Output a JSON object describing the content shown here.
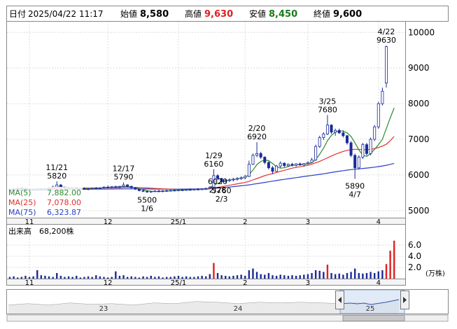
{
  "header": {
    "date_label": "日付",
    "datetime": "2025/04/22 11:17",
    "open_label": "始値",
    "open_value": "8,580",
    "high_label": "高値",
    "high_value": "9,630",
    "low_label": "安値",
    "low_value": "8,450",
    "close_label": "終値",
    "close_value": "9,600"
  },
  "legend": [
    {
      "label": "MA(5)",
      "value": "7,882.00",
      "color": "#2e8b2e"
    },
    {
      "label": "MA(25)",
      "value": "7,078.00",
      "color": "#e03030"
    },
    {
      "label": "MA(75)",
      "value": "6,323.87",
      "color": "#2a40c8"
    }
  ],
  "volume_panel": {
    "title": "出来高",
    "value": "68,200株",
    "unit": "(万株)",
    "ticks": [
      "6.0",
      "4.0",
      "2.0"
    ]
  },
  "navigator": {
    "year_labels": [
      "23",
      "24",
      "25"
    ]
  },
  "colors": {
    "up": "#ffffff",
    "down": "#1a2a9a",
    "vol_normal": "#1a2a9a",
    "vol_high": "#e02020",
    "ma5": "#2e8b2e",
    "ma25": "#e03030",
    "ma75": "#2a40c8"
  },
  "chart_data": {
    "type": "candlestick",
    "x_months": [
      "11",
      "12",
      "25/1",
      "2",
      "3",
      "4"
    ],
    "y_ticks": [
      5000,
      6000,
      7000,
      8000,
      9000,
      10000
    ],
    "ylim": [
      4800,
      10300
    ],
    "annotations": [
      {
        "date": "11/21",
        "value": "5820",
        "position": "above"
      },
      {
        "date": "12/17",
        "value": "5790",
        "position": "above"
      },
      {
        "date": "1/6",
        "value": "5500",
        "position": "below"
      },
      {
        "date": "1/29",
        "value": "6160",
        "position": "above"
      },
      {
        "date": "2/3",
        "value": "5760",
        "position": "below"
      },
      {
        "date": "2/20",
        "value": "6920",
        "position": "above"
      },
      {
        "date": "2/28",
        "value": "6020",
        "position": "below"
      },
      {
        "date": "3/25",
        "value": "7680",
        "position": "above"
      },
      {
        "date": "4/7",
        "value": "5890",
        "position": "below"
      },
      {
        "date": "4/22",
        "value": "9630",
        "position": "above"
      }
    ],
    "candles": [
      {
        "o": 5590,
        "h": 5620,
        "l": 5560,
        "c": 5600
      },
      {
        "o": 5600,
        "h": 5640,
        "l": 5580,
        "c": 5610
      },
      {
        "o": 5610,
        "h": 5650,
        "l": 5590,
        "c": 5630
      },
      {
        "o": 5630,
        "h": 5660,
        "l": 5600,
        "c": 5620
      },
      {
        "o": 5620,
        "h": 5650,
        "l": 5580,
        "c": 5600
      },
      {
        "o": 5600,
        "h": 5620,
        "l": 5560,
        "c": 5580
      },
      {
        "o": 5580,
        "h": 5610,
        "l": 5550,
        "c": 5590
      },
      {
        "o": 5590,
        "h": 5630,
        "l": 5570,
        "c": 5610
      },
      {
        "o": 5610,
        "h": 5640,
        "l": 5580,
        "c": 5600
      },
      {
        "o": 5600,
        "h": 5630,
        "l": 5570,
        "c": 5620
      },
      {
        "o": 5620,
        "h": 5660,
        "l": 5600,
        "c": 5640
      },
      {
        "o": 5640,
        "h": 5700,
        "l": 5610,
        "c": 5660
      },
      {
        "o": 5660,
        "h": 5820,
        "l": 5640,
        "c": 5720
      },
      {
        "o": 5720,
        "h": 5740,
        "l": 5620,
        "c": 5650
      },
      {
        "o": 5650,
        "h": 5670,
        "l": 5600,
        "c": 5620
      },
      {
        "o": 5620,
        "h": 5650,
        "l": 5590,
        "c": 5630
      },
      {
        "o": 5630,
        "h": 5660,
        "l": 5600,
        "c": 5640
      },
      {
        "o": 5640,
        "h": 5660,
        "l": 5600,
        "c": 5610
      },
      {
        "o": 5610,
        "h": 5640,
        "l": 5580,
        "c": 5620
      },
      {
        "o": 5620,
        "h": 5650,
        "l": 5590,
        "c": 5600
      },
      {
        "o": 5600,
        "h": 5630,
        "l": 5570,
        "c": 5610
      },
      {
        "o": 5610,
        "h": 5640,
        "l": 5590,
        "c": 5630
      },
      {
        "o": 5630,
        "h": 5660,
        "l": 5600,
        "c": 5620
      },
      {
        "o": 5620,
        "h": 5650,
        "l": 5600,
        "c": 5640
      },
      {
        "o": 5640,
        "h": 5680,
        "l": 5620,
        "c": 5660
      },
      {
        "o": 5660,
        "h": 5700,
        "l": 5630,
        "c": 5650
      },
      {
        "o": 5650,
        "h": 5680,
        "l": 5620,
        "c": 5670
      },
      {
        "o": 5670,
        "h": 5700,
        "l": 5640,
        "c": 5660
      },
      {
        "o": 5660,
        "h": 5690,
        "l": 5630,
        "c": 5680
      },
      {
        "o": 5680,
        "h": 5790,
        "l": 5660,
        "c": 5720
      },
      {
        "o": 5720,
        "h": 5740,
        "l": 5660,
        "c": 5680
      },
      {
        "o": 5680,
        "h": 5700,
        "l": 5620,
        "c": 5640
      },
      {
        "o": 5640,
        "h": 5660,
        "l": 5580,
        "c": 5600
      },
      {
        "o": 5600,
        "h": 5620,
        "l": 5540,
        "c": 5560
      },
      {
        "o": 5560,
        "h": 5580,
        "l": 5520,
        "c": 5540
      },
      {
        "o": 5540,
        "h": 5560,
        "l": 5500,
        "c": 5520
      },
      {
        "o": 5520,
        "h": 5560,
        "l": 5500,
        "c": 5540
      },
      {
        "o": 5540,
        "h": 5570,
        "l": 5520,
        "c": 5550
      },
      {
        "o": 5550,
        "h": 5580,
        "l": 5520,
        "c": 5540
      },
      {
        "o": 5540,
        "h": 5570,
        "l": 5510,
        "c": 5560
      },
      {
        "o": 5560,
        "h": 5590,
        "l": 5530,
        "c": 5550
      },
      {
        "o": 5550,
        "h": 5580,
        "l": 5530,
        "c": 5570
      },
      {
        "o": 5570,
        "h": 5600,
        "l": 5540,
        "c": 5560
      },
      {
        "o": 5560,
        "h": 5590,
        "l": 5540,
        "c": 5580
      },
      {
        "o": 5580,
        "h": 5610,
        "l": 5550,
        "c": 5570
      },
      {
        "o": 5570,
        "h": 5600,
        "l": 5550,
        "c": 5590
      },
      {
        "o": 5590,
        "h": 5620,
        "l": 5560,
        "c": 5580
      },
      {
        "o": 5580,
        "h": 5610,
        "l": 5560,
        "c": 5600
      },
      {
        "o": 5600,
        "h": 5630,
        "l": 5570,
        "c": 5590
      },
      {
        "o": 5590,
        "h": 5620,
        "l": 5570,
        "c": 5610
      },
      {
        "o": 5610,
        "h": 5650,
        "l": 5580,
        "c": 5620
      },
      {
        "o": 5620,
        "h": 5680,
        "l": 5600,
        "c": 5660
      },
      {
        "o": 5660,
        "h": 6160,
        "l": 5640,
        "c": 5980
      },
      {
        "o": 5980,
        "h": 6020,
        "l": 5860,
        "c": 5900
      },
      {
        "o": 5900,
        "h": 5920,
        "l": 5760,
        "c": 5820
      },
      {
        "o": 5820,
        "h": 5880,
        "l": 5780,
        "c": 5840
      },
      {
        "o": 5840,
        "h": 5900,
        "l": 5800,
        "c": 5860
      },
      {
        "o": 5860,
        "h": 5920,
        "l": 5820,
        "c": 5880
      },
      {
        "o": 5880,
        "h": 5940,
        "l": 5840,
        "c": 5900
      },
      {
        "o": 5900,
        "h": 5960,
        "l": 5860,
        "c": 5920
      },
      {
        "o": 5920,
        "h": 6000,
        "l": 5880,
        "c": 5960
      },
      {
        "o": 5960,
        "h": 6400,
        "l": 5940,
        "c": 6300
      },
      {
        "o": 6300,
        "h": 6600,
        "l": 6280,
        "c": 6550
      },
      {
        "o": 6550,
        "h": 6920,
        "l": 6500,
        "c": 6600
      },
      {
        "o": 6600,
        "h": 6650,
        "l": 6450,
        "c": 6500
      },
      {
        "o": 6500,
        "h": 6520,
        "l": 6300,
        "c": 6350
      },
      {
        "o": 6350,
        "h": 6380,
        "l": 6150,
        "c": 6200
      },
      {
        "o": 6200,
        "h": 6250,
        "l": 6020,
        "c": 6100
      },
      {
        "o": 6100,
        "h": 6280,
        "l": 6080,
        "c": 6250
      },
      {
        "o": 6250,
        "h": 6380,
        "l": 6200,
        "c": 6330
      },
      {
        "o": 6330,
        "h": 6350,
        "l": 6220,
        "c": 6260
      },
      {
        "o": 6260,
        "h": 6320,
        "l": 6220,
        "c": 6300
      },
      {
        "o": 6300,
        "h": 6340,
        "l": 6240,
        "c": 6270
      },
      {
        "o": 6270,
        "h": 6330,
        "l": 6230,
        "c": 6310
      },
      {
        "o": 6310,
        "h": 6350,
        "l": 6260,
        "c": 6280
      },
      {
        "o": 6280,
        "h": 6330,
        "l": 6240,
        "c": 6320
      },
      {
        "o": 6320,
        "h": 6380,
        "l": 6290,
        "c": 6350
      },
      {
        "o": 6350,
        "h": 6480,
        "l": 6330,
        "c": 6420
      },
      {
        "o": 6420,
        "h": 6850,
        "l": 6400,
        "c": 6800
      },
      {
        "o": 6800,
        "h": 7100,
        "l": 6760,
        "c": 7050
      },
      {
        "o": 7050,
        "h": 7200,
        "l": 6980,
        "c": 7150
      },
      {
        "o": 7150,
        "h": 7680,
        "l": 7120,
        "c": 7400
      },
      {
        "o": 7400,
        "h": 7420,
        "l": 7150,
        "c": 7200
      },
      {
        "o": 7200,
        "h": 7300,
        "l": 7100,
        "c": 7250
      },
      {
        "o": 7250,
        "h": 7300,
        "l": 7150,
        "c": 7180
      },
      {
        "o": 7180,
        "h": 7250,
        "l": 7050,
        "c": 7100
      },
      {
        "o": 7100,
        "h": 7120,
        "l": 6850,
        "c": 6900
      },
      {
        "o": 6900,
        "h": 6950,
        "l": 6500,
        "c": 6550
      },
      {
        "o": 6550,
        "h": 6600,
        "l": 5890,
        "c": 6200
      },
      {
        "o": 6200,
        "h": 6550,
        "l": 6150,
        "c": 6500
      },
      {
        "o": 6500,
        "h": 6900,
        "l": 6450,
        "c": 6850
      },
      {
        "o": 6850,
        "h": 6900,
        "l": 6550,
        "c": 6600
      },
      {
        "o": 6600,
        "h": 7050,
        "l": 6550,
        "c": 7000
      },
      {
        "o": 7000,
        "h": 7400,
        "l": 6950,
        "c": 7350
      },
      {
        "o": 7350,
        "h": 8050,
        "l": 7300,
        "c": 8000
      },
      {
        "o": 8000,
        "h": 8450,
        "l": 7950,
        "c": 8350
      },
      {
        "o": 8580,
        "h": 9630,
        "l": 8450,
        "c": 9600
      }
    ],
    "ma5": [
      5600,
      5610,
      5615,
      5620,
      5612,
      5600,
      5598,
      5600,
      5606,
      5610,
      5620,
      5640,
      5660,
      5662,
      5658,
      5648,
      5636,
      5628,
      5620,
      5618,
      5616,
      5618,
      5620,
      5630,
      5640,
      5648,
      5660,
      5662,
      5670,
      5676,
      5672,
      5660,
      5640,
      5612,
      5588,
      5560,
      5542,
      5536,
      5534,
      5540,
      5548,
      5554,
      5560,
      5566,
      5572,
      5578,
      5584,
      5590,
      5596,
      5602,
      5610,
      5630,
      5720,
      5760,
      5800,
      5840,
      5860,
      5870,
      5890,
      5910,
      5930,
      6010,
      6140,
      6290,
      6380,
      6420,
      6400,
      6320,
      6230,
      6190,
      6200,
      6240,
      6270,
      6280,
      6290,
      6300,
      6310,
      6340,
      6430,
      6580,
      6750,
      6960,
      7110,
      7200,
      7240,
      7230,
      7180,
      7080,
      6900,
      6700,
      6560,
      6520,
      6600,
      6720,
      6850,
      7000,
      7300,
      7600,
      7882
    ],
    "ma25": [
      5580,
      5585,
      5590,
      5594,
      5596,
      5598,
      5600,
      5602,
      5604,
      5606,
      5610,
      5614,
      5620,
      5624,
      5626,
      5628,
      5630,
      5630,
      5630,
      5630,
      5630,
      5630,
      5632,
      5634,
      5636,
      5638,
      5640,
      5642,
      5644,
      5648,
      5650,
      5650,
      5648,
      5645,
      5640,
      5634,
      5628,
      5622,
      5616,
      5610,
      5605,
      5600,
      5596,
      5594,
      5592,
      5590,
      5590,
      5592,
      5594,
      5596,
      5600,
      5610,
      5630,
      5650,
      5670,
      5690,
      5710,
      5730,
      5750,
      5770,
      5790,
      5820,
      5860,
      5900,
      5940,
      5980,
      6010,
      6040,
      6070,
      6100,
      6130,
      6160,
      6190,
      6210,
      6230,
      6250,
      6270,
      6300,
      6340,
      6380,
      6430,
      6480,
      6530,
      6580,
      6620,
      6660,
      6690,
      6710,
      6720,
      6720,
      6710,
      6710,
      6720,
      6740,
      6770,
      6810,
      6860,
      6960,
      7078
    ],
    "ma75": [
      5560,
      5562,
      5564,
      5566,
      5568,
      5570,
      5572,
      5574,
      5576,
      5578,
      5580,
      5582,
      5584,
      5586,
      5588,
      5590,
      5592,
      5594,
      5596,
      5598,
      5600,
      5601,
      5602,
      5603,
      5604,
      5605,
      5606,
      5607,
      5608,
      5609,
      5610,
      5610,
      5610,
      5609,
      5608,
      5607,
      5606,
      5605,
      5604,
      5603,
      5602,
      5602,
      5602,
      5602,
      5603,
      5604,
      5605,
      5606,
      5608,
      5610,
      5612,
      5616,
      5622,
      5630,
      5640,
      5650,
      5660,
      5672,
      5684,
      5696,
      5708,
      5722,
      5738,
      5755,
      5772,
      5790,
      5808,
      5826,
      5844,
      5860,
      5876,
      5892,
      5908,
      5924,
      5940,
      5956,
      5970,
      5985,
      6000,
      6015,
      6032,
      6050,
      6068,
      6086,
      6104,
      6120,
      6136,
      6150,
      6162,
      6172,
      6182,
      6192,
      6204,
      6218,
      6234,
      6252,
      6272,
      6296,
      6324
    ],
    "volume": [
      0.3,
      0.4,
      0.2,
      0.3,
      0.5,
      0.3,
      0.4,
      1.5,
      0.6,
      0.5,
      0.4,
      0.3,
      1.0,
      0.5,
      0.3,
      0.4,
      0.3,
      0.5,
      0.2,
      0.3,
      0.4,
      0.3,
      0.6,
      0.4,
      0.3,
      0.2,
      0.3,
      1.3,
      0.5,
      0.6,
      0.3,
      0.4,
      0.3,
      0.2,
      0.4,
      0.3,
      0.5,
      0.3,
      0.4,
      0.2,
      0.3,
      0.3,
      0.4,
      0.5,
      0.3,
      0.4,
      0.3,
      0.3,
      0.4,
      0.5,
      0.4,
      0.8,
      2.8,
      1.0,
      0.6,
      0.5,
      0.4,
      0.5,
      0.6,
      0.7,
      0.5,
      1.5,
      1.8,
      1.2,
      0.8,
      0.7,
      1.0,
      0.6,
      0.5,
      0.7,
      0.6,
      0.5,
      0.6,
      0.5,
      0.6,
      0.7,
      0.8,
      1.0,
      1.5,
      1.4,
      1.2,
      2.5,
      1.0,
      0.8,
      0.9,
      0.7,
      1.0,
      1.2,
      1.8,
      1.0,
      0.9,
      1.0,
      1.2,
      1.0,
      1.3,
      1.5,
      2.6,
      5.0,
      6.8
    ],
    "volume_ylim": [
      0,
      7.4
    ]
  }
}
